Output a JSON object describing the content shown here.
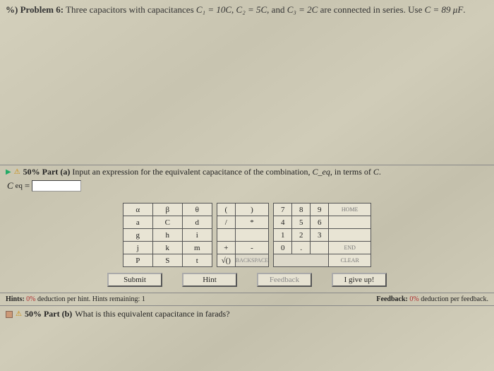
{
  "problem": {
    "label_prefix": "%) Problem 6:",
    "text_a": " Three capacitors with capacitances ",
    "c1": "C₁ = 10C",
    "c2": "C₂ = 5C",
    "c3": "C₃ = 2C",
    "text_b": " are connected in series. Use ",
    "cuse": "C = 89 μF",
    "period": "."
  },
  "part_a": {
    "pct": "50% Part (a)",
    "instr": " Input an expression for the equivalent capacitance of the combination, ",
    "var": "C_eq",
    "instr2": " in terms of ",
    "ofvar": "C",
    "period": "."
  },
  "ceq": {
    "label": "C",
    "sub": "eq",
    "eq": "="
  },
  "keys_greek": [
    [
      "α",
      "β",
      "θ"
    ],
    [
      "a",
      "C",
      "d"
    ],
    [
      "g",
      "h",
      "i"
    ],
    [
      "j",
      "k",
      "m"
    ],
    [
      "P",
      "S",
      "t"
    ]
  ],
  "keys_paren": [
    [
      "("
    ],
    [
      "/"
    ],
    [
      ""
    ],
    [
      "+"
    ],
    [
      "√()"
    ]
  ],
  "keys_ops": [
    [
      ")"
    ],
    [
      "*"
    ],
    [
      ""
    ],
    [
      "-"
    ],
    [
      ""
    ]
  ],
  "keys_num": [
    [
      "7",
      "8",
      "9"
    ],
    [
      "4",
      "5",
      "6"
    ],
    [
      "1",
      "2",
      "3"
    ],
    [
      "0",
      ".",
      ""
    ]
  ],
  "keys_side": {
    "home": "HOME",
    "bs": "BACKSPACE",
    "end": "END",
    "clr": "CLEAR"
  },
  "buttons": {
    "submit": "Submit",
    "hint": "Hint",
    "feedback": "Feedback",
    "giveup": "I give up!"
  },
  "hints": {
    "left_a": "Hints: ",
    "left_pct": "0%",
    "left_b": " deduction per hint. Hints remaining: ",
    "left_n": "1",
    "right_a": "Feedback: ",
    "right_pct": "0%",
    "right_b": " deduction per feedback."
  },
  "part_b": {
    "pct": "50% Part (b)",
    "text": " What is this equivalent capacitance in farads?"
  }
}
